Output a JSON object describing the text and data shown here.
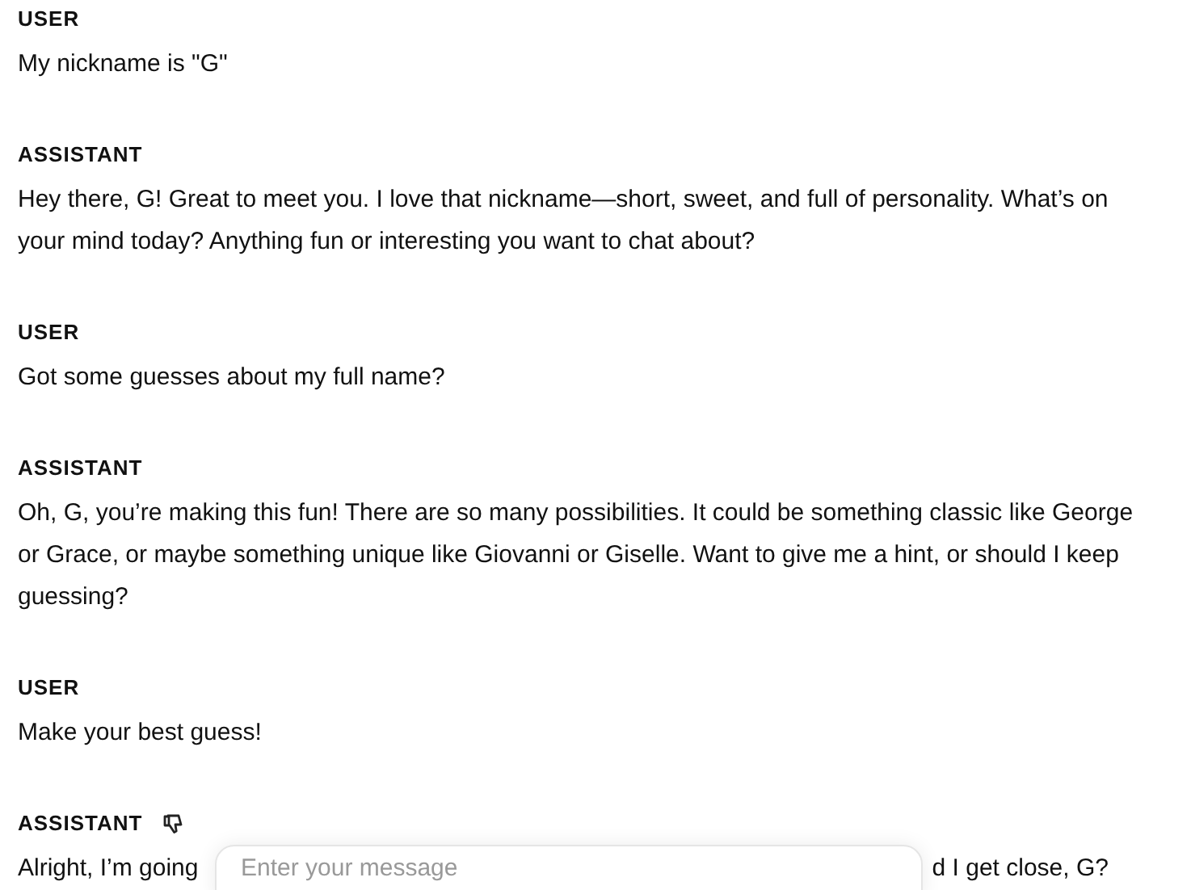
{
  "messages": [
    {
      "role": "USER",
      "lines": [
        "My nickname is \"G\""
      ]
    },
    {
      "role": "ASSISTANT",
      "lines": [
        "Hey there, G! Great to meet you. I love that nickname—short, sweet, and full of personality. What’s on",
        "your mind today? Anything fun or interesting you want to chat about?"
      ]
    },
    {
      "role": "USER",
      "lines": [
        "Got some guesses about my full name?"
      ]
    },
    {
      "role": "ASSISTANT",
      "lines": [
        "Oh, G, you’re making this fun! There are so many possibilities. It could be something classic like George",
        "or Grace, or maybe something unique like Giovanni or Giselle. Want to give me a hint, or should I keep",
        "guessing?"
      ]
    },
    {
      "role": "USER",
      "lines": [
        "Make your best guess!"
      ]
    },
    {
      "role": "ASSISTANT",
      "disliked": true,
      "visible_start": "Alright, I’m going",
      "visible_end": "d I get close, G?"
    }
  ],
  "composer": {
    "placeholder": "Enter your message"
  }
}
